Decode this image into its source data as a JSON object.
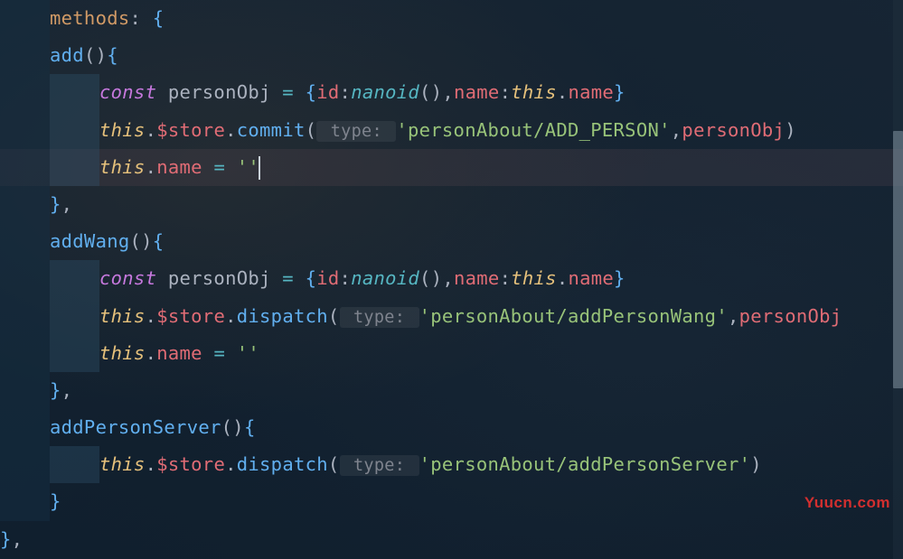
{
  "code": {
    "line1_methods": "methods",
    "line1_colon": ": ",
    "line1_brace": "{",
    "line2_add": "add",
    "line2_parens": "()",
    "line2_brace": "{",
    "line3_const": "const",
    "line3_personObj": " personObj ",
    "line3_eq": "= ",
    "line3_braceL": "{",
    "line3_id": "id",
    "line3_colon1": ":",
    "line3_nanoid": "nanoid",
    "line3_nanoidCall": "()",
    "line3_comma": ",",
    "line3_name": "name",
    "line3_colon2": ":",
    "line3_this": "this",
    "line3_dot": ".",
    "line3_nameProp": "name",
    "line3_braceR": "}",
    "line4_this": "this",
    "line4_dot1": ".",
    "line4_store": "$store",
    "line4_dot2": ".",
    "line4_commit": "commit",
    "line4_parenL": "(",
    "line4_hint": " type: ",
    "line4_string": "'personAbout/ADD_PERSON'",
    "line4_comma": ",",
    "line4_personObj": "personObj",
    "line4_parenR": ")",
    "line5_this": "this",
    "line5_dot": ".",
    "line5_name": "name",
    "line5_eq": " = ",
    "line5_string": "''",
    "line6_brace": "}",
    "line6_comma": ",",
    "line7_addWang": "addWang",
    "line7_parens": "()",
    "line7_brace": "{",
    "line8_const": "const",
    "line8_personObj": " personObj ",
    "line8_eq": "= ",
    "line8_braceL": "{",
    "line8_id": "id",
    "line8_colon1": ":",
    "line8_nanoid": "nanoid",
    "line8_nanoidCall": "()",
    "line8_comma": ",",
    "line8_name": "name",
    "line8_colon2": ":",
    "line8_this": "this",
    "line8_dot": ".",
    "line8_nameProp": "name",
    "line8_braceR": "}",
    "line9_this": "this",
    "line9_dot1": ".",
    "line9_store": "$store",
    "line9_dot2": ".",
    "line9_dispatch": "dispatch",
    "line9_parenL": "(",
    "line9_hint": " type: ",
    "line9_string": "'personAbout/addPersonWang'",
    "line9_comma": ",",
    "line9_personObj": "personObj",
    "line10_this": "this",
    "line10_dot": ".",
    "line10_name": "name",
    "line10_eq": " = ",
    "line10_string": "''",
    "line11_brace": "}",
    "line11_comma": ",",
    "line12_addPersonServer": "addPersonServer",
    "line12_parens": "()",
    "line12_brace": "{",
    "line13_this": "this",
    "line13_dot1": ".",
    "line13_store": "$store",
    "line13_dot2": ".",
    "line13_dispatch": "dispatch",
    "line13_parenL": "(",
    "line13_hint": " type: ",
    "line13_string": "'personAbout/addPersonServer'",
    "line13_parenR": ")",
    "line14_brace": "}",
    "line15_brace": "}",
    "line15_comma": ","
  },
  "watermark": "Yuucn.com"
}
